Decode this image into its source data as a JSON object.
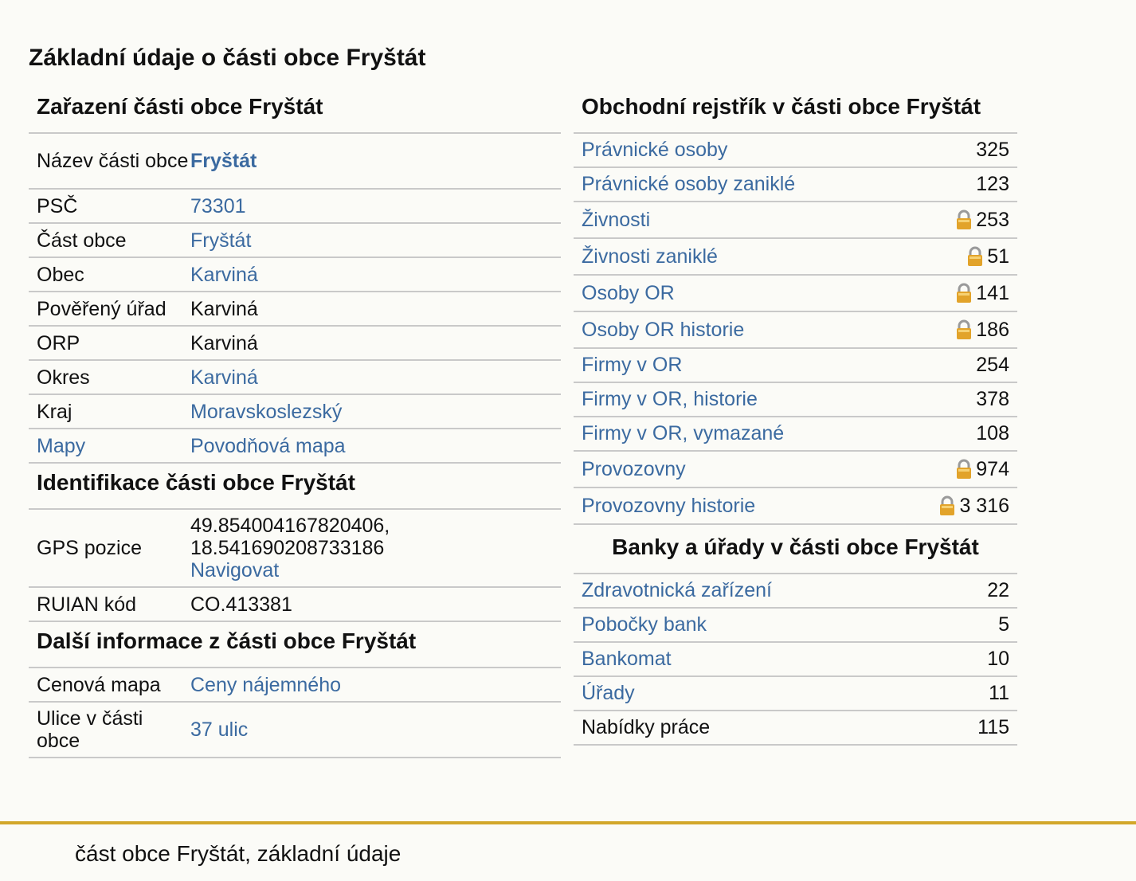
{
  "page_title": "Základní údaje o části obce Fryštát",
  "zarazeni": {
    "title": "Zařazení části obce Fryštát",
    "rows": [
      {
        "label": "Název části obce",
        "value": "Fryštát"
      },
      {
        "label": "PSČ",
        "value": "73301"
      },
      {
        "label": "Část obce",
        "value": "Fryštát"
      },
      {
        "label": "Obec",
        "value": "Karviná"
      },
      {
        "label": "Pověřený úřad",
        "value": "Karviná"
      },
      {
        "label": "ORP",
        "value": "Karviná"
      },
      {
        "label": "Okres",
        "value": "Karviná"
      },
      {
        "label": "Kraj",
        "value": "Moravskoslezský"
      },
      {
        "label": "Mapy",
        "value": "Povodňová mapa"
      }
    ]
  },
  "identifikace": {
    "title": "Identifikace části obce Fryštát",
    "gps_label": "GPS pozice",
    "gps_line1": "49.854004167820406,",
    "gps_line2": "18.541690208733186",
    "navigate": "Navigovat",
    "ruian_label": "RUIAN kód",
    "ruian_value": "CO.413381"
  },
  "dalsi": {
    "title": "Další informace z části obce Fryštát",
    "rows": [
      {
        "label": "Cenová mapa",
        "value": "Ceny nájemného"
      },
      {
        "label": "Ulice v části obce",
        "value": "37 ulic"
      }
    ]
  },
  "rejstrik": {
    "title": "Obchodní rejstřík v části obce Fryštát",
    "rows": [
      {
        "label": "Právnické osoby",
        "value": "325",
        "locked": false
      },
      {
        "label": "Právnické osoby zaniklé",
        "value": "123",
        "locked": false
      },
      {
        "label": "Živnosti",
        "value": "253",
        "locked": true
      },
      {
        "label": "Živnosti zaniklé",
        "value": "51",
        "locked": true
      },
      {
        "label": "Osoby OR",
        "value": "141",
        "locked": true
      },
      {
        "label": "Osoby OR historie",
        "value": "186",
        "locked": true
      },
      {
        "label": "Firmy v OR",
        "value": "254",
        "locked": false
      },
      {
        "label": "Firmy v OR, historie",
        "value": "378",
        "locked": false
      },
      {
        "label": "Firmy v OR, vymazané",
        "value": "108",
        "locked": false
      },
      {
        "label": "Provozovny",
        "value": "974",
        "locked": true
      },
      {
        "label": "Provozovny historie",
        "value": "3 316",
        "locked": true
      }
    ]
  },
  "banky": {
    "title": "Banky a úřady v části obce Fryštát",
    "rows": [
      {
        "label": "Zdravotnická zařízení",
        "value": "22"
      },
      {
        "label": "Pobočky bank",
        "value": "5"
      },
      {
        "label": "Bankomat",
        "value": "10"
      },
      {
        "label": "Úřady",
        "value": "11"
      },
      {
        "label": "Nabídky práce",
        "value": "115"
      }
    ]
  },
  "footer_text": "část obce Fryštát, základní údaje",
  "colors": {
    "link": "#3b6aa0",
    "footer_bar": "#d2a72a",
    "lock": "#e2a32a"
  }
}
